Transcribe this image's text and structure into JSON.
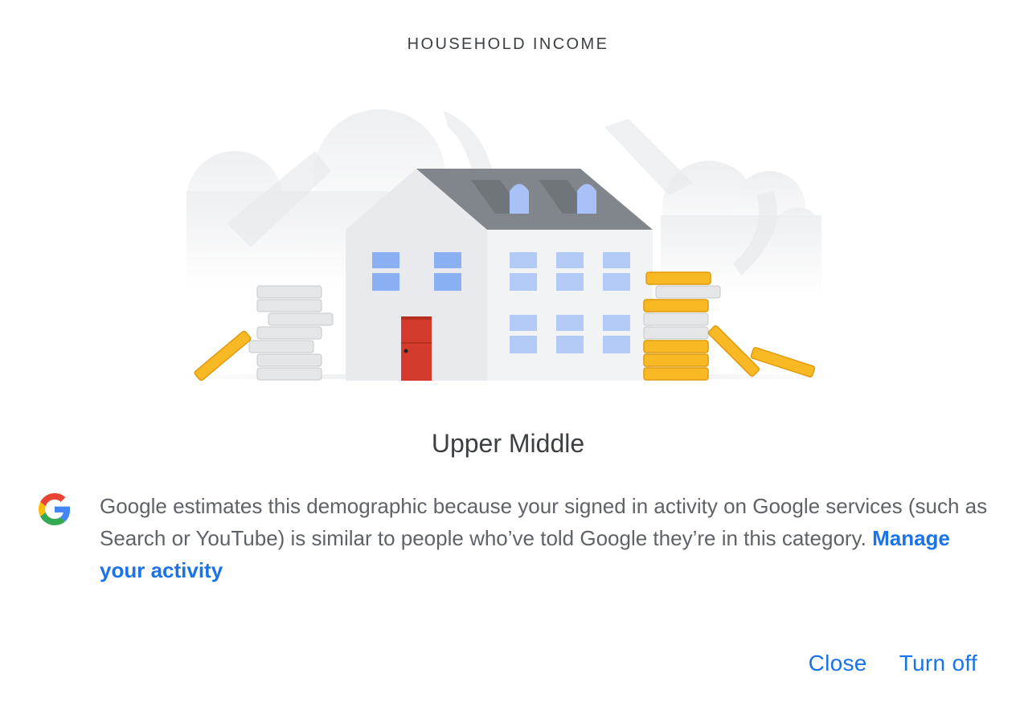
{
  "dialog": {
    "eyebrow": "HOUSEHOLD INCOME",
    "value": "Upper Middle",
    "explanation": "Google estimates this demographic because your signed in activity on Google services (such as Search or YouTube) is similar to people who’ve told Google they’re in this category.",
    "link_label": "Manage your activity",
    "close_label": "Close",
    "turn_off_label": "Turn off"
  },
  "colors": {
    "accent": "#1a73e8",
    "text_primary": "#3c4043",
    "text_secondary": "#5f6368",
    "coin_gold": "#f9b924",
    "coin_silver": "#dadce0",
    "door_red": "#d33b2c",
    "window_blue": "#a8c1f7",
    "roof_gray": "#80868b"
  },
  "icons": {
    "brand": "google-g-icon",
    "illustration": "house-with-coins-illustration"
  }
}
